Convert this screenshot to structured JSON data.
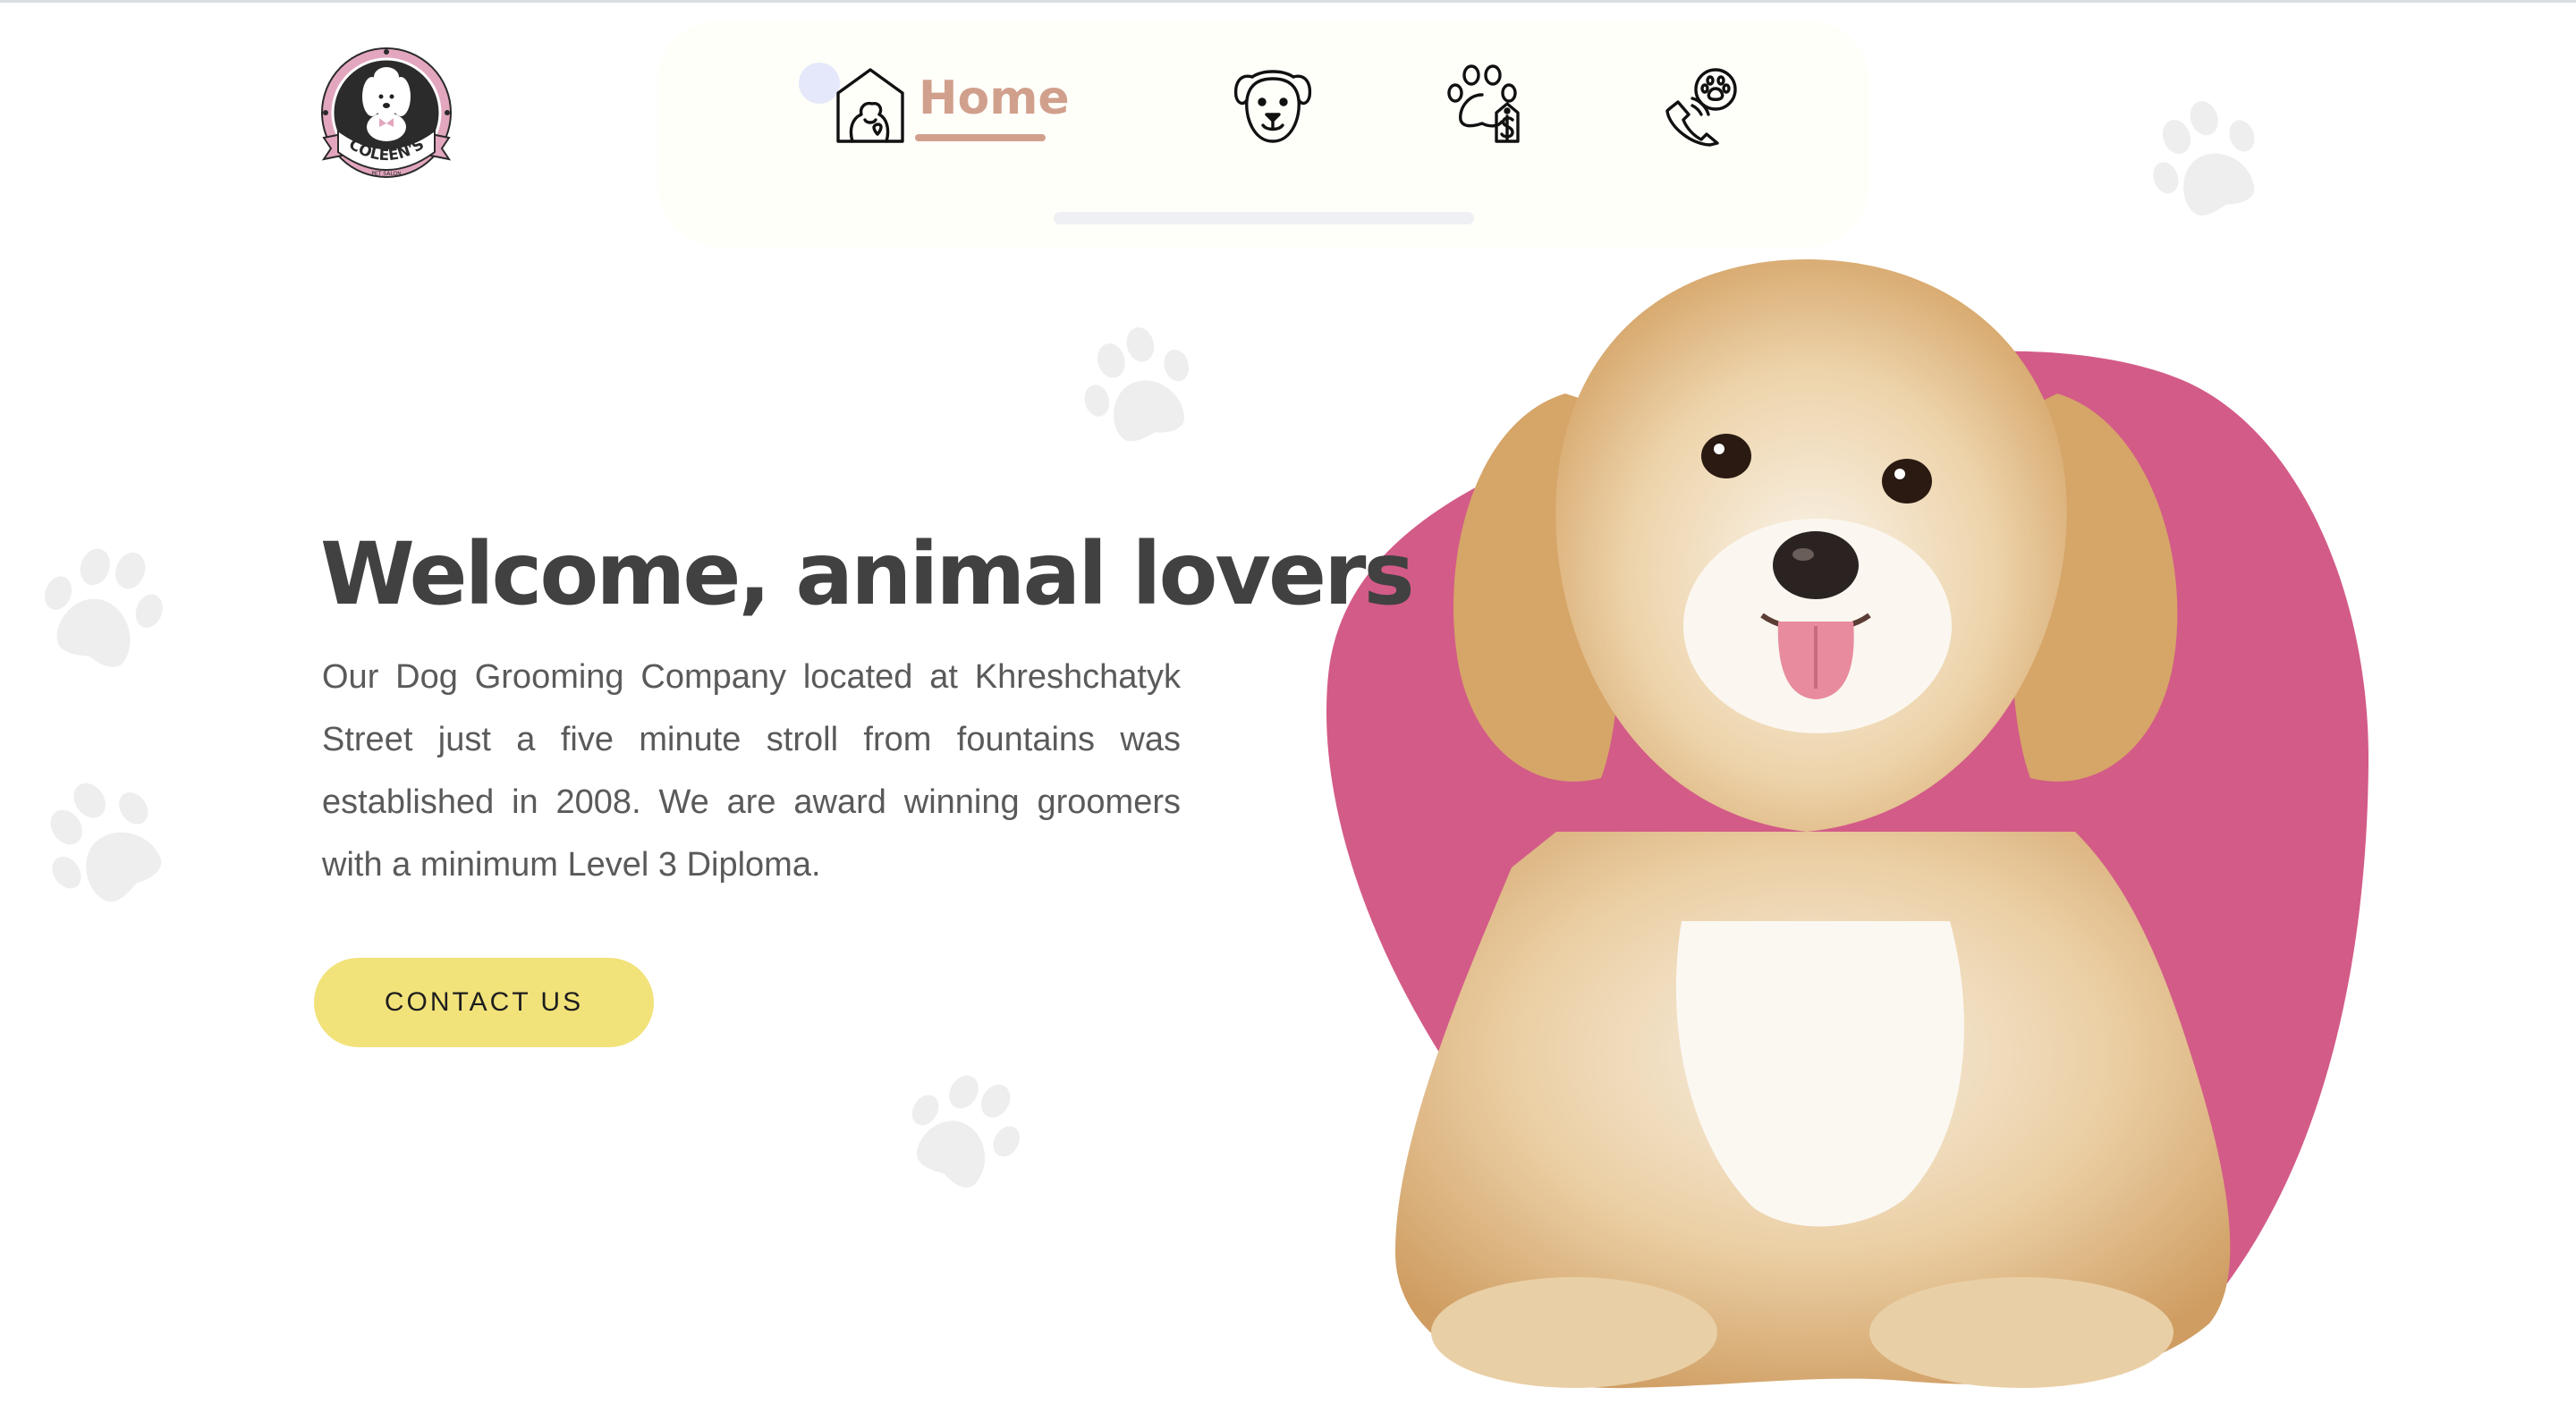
{
  "brand": {
    "logo_icon": "poodle-badge-logo",
    "logo_text": "COLEEN'S",
    "logo_subtext": "PET SALON",
    "colors": {
      "pink": "#e3a6bf",
      "dark": "#2a2a2a"
    }
  },
  "nav": {
    "items": [
      {
        "label": "Home",
        "icon": "home-pet-icon",
        "active": true
      },
      {
        "label": "",
        "icon": "dog-face-icon",
        "active": false
      },
      {
        "label": "",
        "icon": "paw-price-tag-icon",
        "active": false
      },
      {
        "label": "",
        "icon": "phone-paw-icon",
        "active": false
      }
    ],
    "active_color": "#d1a08d"
  },
  "hero": {
    "title": "Welcome, animal lovers",
    "description": "Our Dog Grooming Company located at Khreshchatyk Street just a five minute stroll from fountains was established in 2008. We are award winning groomers with a minimum Level 3 Diploma.",
    "cta_label": "CONTACT US",
    "cta_color": "#f2e27a",
    "blob_color": "#d35b88",
    "image": "fluffy-havanese-puppy"
  },
  "decor": {
    "background_icon": "paw-print-icon",
    "paw_color": "#eeeeee"
  }
}
